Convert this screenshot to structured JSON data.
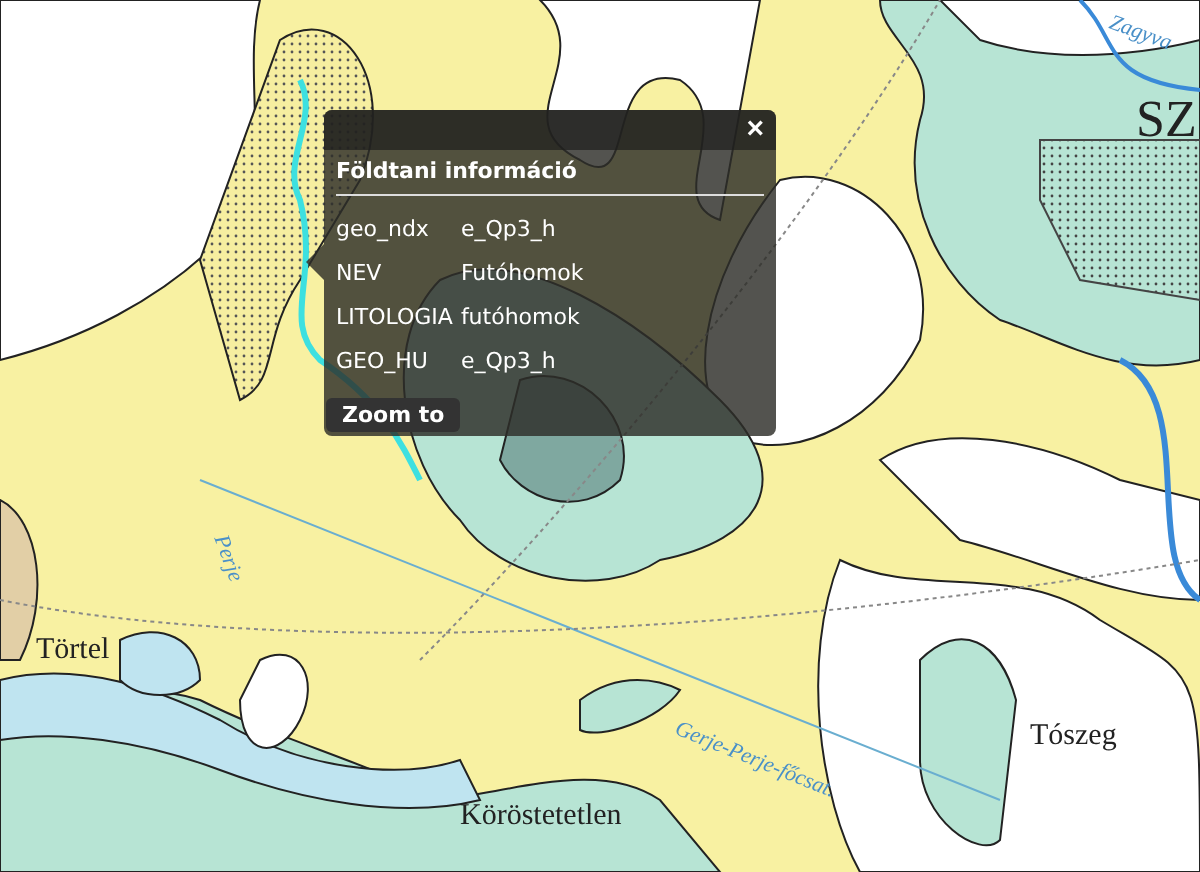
{
  "map": {
    "labels": [
      {
        "text": "SZ",
        "kind": "town"
      },
      {
        "text": "Zagyva",
        "kind": "waterway"
      },
      {
        "text": "Perje",
        "kind": "waterway"
      },
      {
        "text": "Törtel",
        "kind": "town"
      },
      {
        "text": "Gerje-Perje-főcsat.",
        "kind": "waterway"
      },
      {
        "text": "Tószeg",
        "kind": "town"
      },
      {
        "text": "Köröstetetlen",
        "kind": "town"
      }
    ]
  },
  "popup": {
    "close": "×",
    "title": "Földtani információ",
    "fields": [
      {
        "name": "geo_ndx",
        "value": "e_Qp3_h"
      },
      {
        "name": "NEV",
        "value": "Futóhomok"
      },
      {
        "name": "LITOLOGIA",
        "value": "futóhomok"
      },
      {
        "name": "GEO_HU",
        "value": "e_Qp3_h"
      }
    ],
    "button": "Zoom to"
  }
}
